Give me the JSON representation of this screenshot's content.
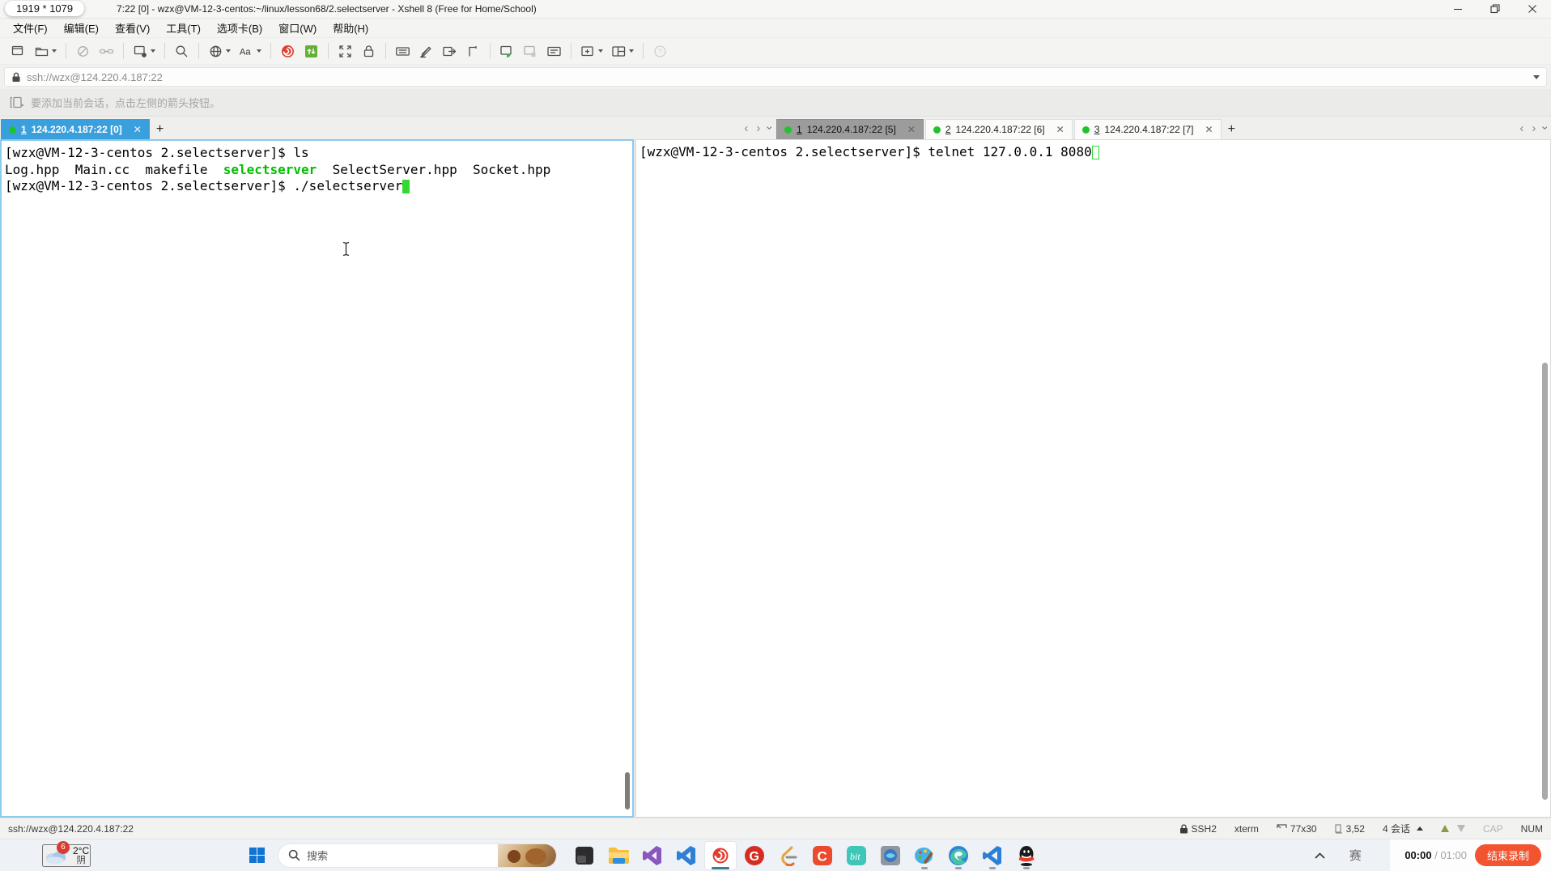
{
  "colors": {
    "tab_active_bg": "#3a9fdd",
    "tab_unfocused_bg": "#9c9c9c",
    "terminal_green": "#00bf00",
    "cursor_green": "#33d833",
    "focus_border": "#8ec9ee",
    "record_button": "#f25430",
    "windows_blue": "#1173d2",
    "status_dot_green": "#21c32d"
  },
  "titlebar": {
    "size_overlay": "1919 * 1079",
    "title": "7:22 [0] - wzx@VM-12-3-centos:~/linux/lesson68/2.selectserver - Xshell 8 (Free for Home/School)"
  },
  "menubar": {
    "items": [
      {
        "name": "menu-file",
        "label": "文件(F)"
      },
      {
        "name": "menu-edit",
        "label": "编辑(E)"
      },
      {
        "name": "menu-view",
        "label": "查看(V)"
      },
      {
        "name": "menu-tools",
        "label": "工具(T)"
      },
      {
        "name": "menu-tab",
        "label": "选项卡(B)"
      },
      {
        "name": "menu-window",
        "label": "窗口(W)"
      },
      {
        "name": "menu-help",
        "label": "帮助(H)"
      }
    ]
  },
  "toolbar": {
    "buttons": [
      {
        "name": "new-session",
        "icon": "window-new"
      },
      {
        "name": "open-sessions",
        "icon": "folder",
        "caret": true
      },
      {
        "sep": true
      },
      {
        "name": "disconnect",
        "icon": "disconnect",
        "disabled": true
      },
      {
        "name": "reconnect",
        "icon": "chain-link",
        "disabled": true
      },
      {
        "sep": true
      },
      {
        "name": "duplicate-session",
        "icon": "window-session",
        "caret": true
      },
      {
        "sep": true
      },
      {
        "name": "find",
        "icon": "magnifier"
      },
      {
        "sep": true
      },
      {
        "name": "encoding",
        "icon": "globe",
        "caret": true
      },
      {
        "name": "font",
        "icon": "font-aa",
        "caret": true
      },
      {
        "sep": true
      },
      {
        "name": "xagent",
        "icon": "xshell-swirl"
      },
      {
        "name": "xftp",
        "icon": "xftp-badge"
      },
      {
        "sep": true
      },
      {
        "name": "fullscreen",
        "icon": "expand-arrows"
      },
      {
        "name": "lock-screen",
        "icon": "padlock"
      },
      {
        "sep": true
      },
      {
        "name": "virtual-keyboard",
        "icon": "keyboard"
      },
      {
        "name": "highlight-sets",
        "icon": "pen"
      },
      {
        "name": "send-text",
        "icon": "window-arrow"
      },
      {
        "name": "rename-tab",
        "icon": "tab-shape"
      },
      {
        "sep": true
      },
      {
        "name": "run-script",
        "icon": "window-play"
      },
      {
        "name": "stop-script",
        "icon": "window-stop",
        "disabled": true
      },
      {
        "name": "compose-bar",
        "icon": "compose"
      },
      {
        "sep": true
      },
      {
        "name": "new-tab",
        "icon": "window-plus",
        "caret": true
      },
      {
        "name": "tile-layout",
        "icon": "split-grid",
        "caret": true
      },
      {
        "sep": true
      },
      {
        "name": "help",
        "icon": "help-circle",
        "disabled": true
      }
    ]
  },
  "addressbar": {
    "value": "ssh://wzx@124.220.4.187:22"
  },
  "infobar": {
    "message": "要添加当前会话，点击左侧的箭头按钮。"
  },
  "tab_groups": {
    "left": {
      "tabs": [
        {
          "index": "1",
          "label": "124.220.4.187:22 [0]",
          "state": "active-focused"
        }
      ]
    },
    "right": {
      "tabs": [
        {
          "index": "1",
          "label": "124.220.4.187:22 [5]",
          "state": "active-unfocused"
        },
        {
          "index": "2",
          "label": "124.220.4.187:22 [6]",
          "state": "inactive"
        },
        {
          "index": "3",
          "label": "124.220.4.187:22 [7]",
          "state": "inactive"
        }
      ]
    }
  },
  "terminals": {
    "left": {
      "lines": [
        [
          {
            "t": "[wzx@VM-12-3-centos 2.selectserver]$ ls"
          }
        ],
        [
          {
            "t": "Log.hpp  Main.cc  makefile  "
          },
          {
            "t": "selectserver",
            "c": "green"
          },
          {
            "t": "  SelectServer.hpp  Socket.hpp"
          }
        ],
        [
          {
            "t": "[wzx@VM-12-3-centos 2.selectserver]$ ./selectserver"
          },
          {
            "cursor": "block"
          }
        ]
      ]
    },
    "right": {
      "lines": [
        [
          {
            "t": "[wzx@VM-12-3-centos 2.selectserver]$ telnet 127.0.0.1 8080"
          },
          {
            "cursor": "outline"
          }
        ]
      ]
    }
  },
  "statusbar": {
    "session_url": "ssh://wzx@124.220.4.187:22",
    "items": [
      {
        "name": "protocol",
        "icon": "lock-small",
        "label": "SSH2"
      },
      {
        "name": "terminal-type",
        "label": "xterm"
      },
      {
        "name": "screen-size",
        "icon": "size-corner",
        "label": "77x30"
      },
      {
        "name": "cursor-position",
        "icon": "cursor-pos",
        "label": "3,52"
      },
      {
        "name": "session-count",
        "label": "4 会话",
        "caret_up": true
      },
      {
        "name": "scroll-arrows"
      },
      {
        "name": "caps-lock",
        "label": "CAP",
        "dim": true
      },
      {
        "name": "num-lock",
        "label": "NUM"
      }
    ]
  },
  "taskbar": {
    "weather": {
      "badge": "6",
      "temperature": "2°C",
      "condition": "阴"
    },
    "search": {
      "placeholder": "搜索"
    },
    "apps": [
      {
        "name": "terminal-app"
      },
      {
        "name": "file-explorer"
      },
      {
        "name": "visual-studio"
      },
      {
        "name": "visual-studio-blue"
      },
      {
        "name": "xshell",
        "active": true
      },
      {
        "name": "gitee"
      },
      {
        "name": "leetcode"
      },
      {
        "name": "csdn"
      },
      {
        "name": "bit-app"
      },
      {
        "name": "remote-desktop"
      },
      {
        "name": "paint-app",
        "running": true
      },
      {
        "name": "edge",
        "running": true
      },
      {
        "name": "vscode",
        "running": true
      },
      {
        "name": "qq",
        "running": true
      }
    ],
    "tray": {
      "ime_label": "赛"
    },
    "recorder": {
      "elapsed": "00:00",
      "separator": "/",
      "duration": "01:00",
      "stop_label": "结束录制"
    }
  }
}
